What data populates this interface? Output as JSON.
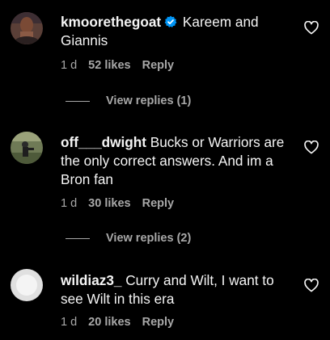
{
  "comments": [
    {
      "username": "kmoorethegoat",
      "verified": true,
      "text": " Kareem and Giannis",
      "time": "1 d",
      "likes": "52 likes",
      "reply": "Reply",
      "view_replies": "View replies (1)",
      "avatar_icon": "profile-photo"
    },
    {
      "username": "off___dwight",
      "verified": false,
      "text": " Bucks or Warriors are the only correct answers. And im a Bron fan",
      "time": "1 d",
      "likes": "30 likes",
      "reply": "Reply",
      "view_replies": "View replies (2)",
      "avatar_icon": "profile-photo"
    },
    {
      "username": "wildiaz3_",
      "verified": false,
      "text": "  Curry and Wilt, I want to see Wilt in this era",
      "time": "1 d",
      "likes": "20 likes",
      "reply": "Reply",
      "avatar_icon": "default-avatar"
    }
  ],
  "colors": {
    "background": "#000000",
    "text": "#f5f5f5",
    "secondary": "#a8a8a8",
    "verified_blue": "#0095f6"
  },
  "icons": {
    "like": "heart-outline-icon",
    "verified": "verified-badge-icon"
  }
}
